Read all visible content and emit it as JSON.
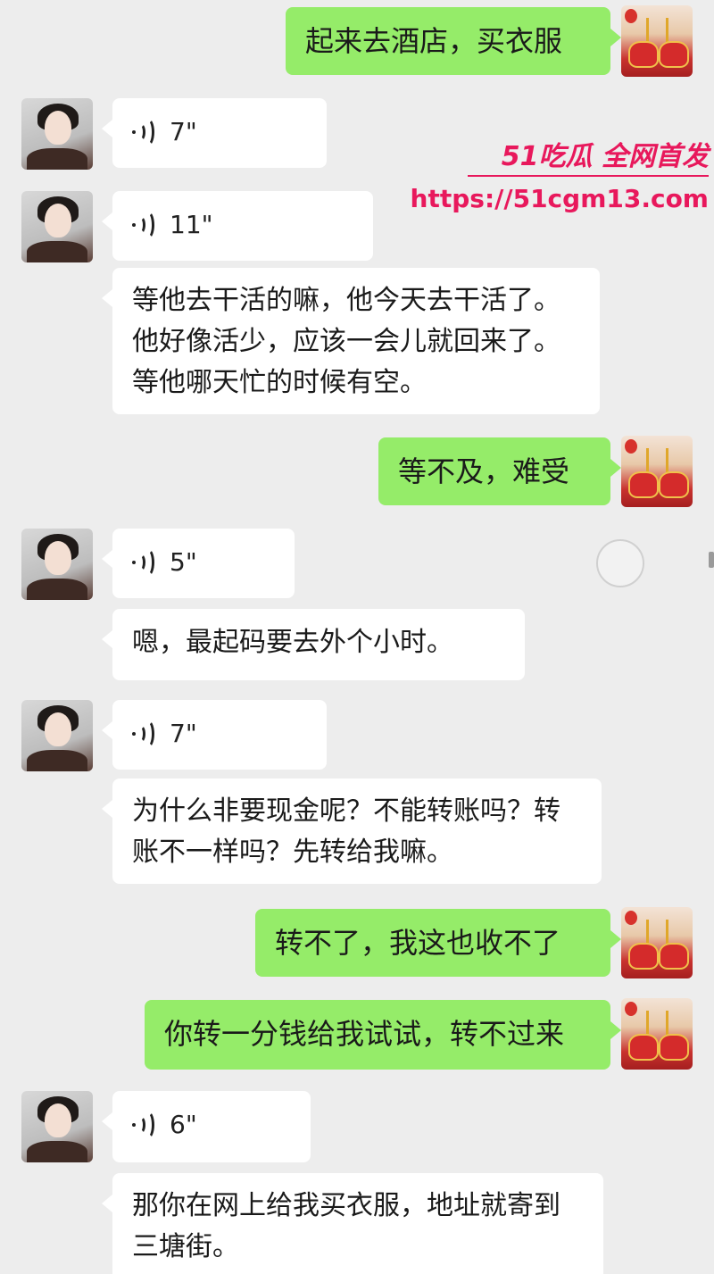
{
  "watermark": {
    "brand": "51吃瓜 全网首发",
    "url": "https://51cgm13.com"
  },
  "messages": [
    {
      "side": "out",
      "type": "text",
      "text": "起来去酒店，买衣服"
    },
    {
      "side": "in",
      "type": "voice",
      "duration": "7\""
    },
    {
      "side": "in",
      "type": "voice",
      "duration": "11\""
    },
    {
      "side": "in",
      "type": "text",
      "text": "等他去干活的嘛，他今天去干活了。他好像活少，应该一会儿就回来了。等他哪天忙的时候有空。"
    },
    {
      "side": "out",
      "type": "text",
      "text": "等不及，难受"
    },
    {
      "side": "in",
      "type": "voice",
      "duration": "5\""
    },
    {
      "side": "in",
      "type": "text",
      "text": "嗯，最起码要去外个小时。"
    },
    {
      "side": "in",
      "type": "voice",
      "duration": "7\""
    },
    {
      "side": "in",
      "type": "text",
      "text": "为什么非要现金呢？不能转账吗？转账不一样吗？先转给我嘛。"
    },
    {
      "side": "out",
      "type": "text",
      "text": "转不了，我这也收不了"
    },
    {
      "side": "out",
      "type": "text",
      "text": "你转一分钱给我试试，转不过来"
    },
    {
      "side": "in",
      "type": "voice",
      "duration": "6\""
    },
    {
      "side": "in",
      "type": "text",
      "text": "那你在网上给我买衣服，地址就寄到三塘街。"
    }
  ]
}
